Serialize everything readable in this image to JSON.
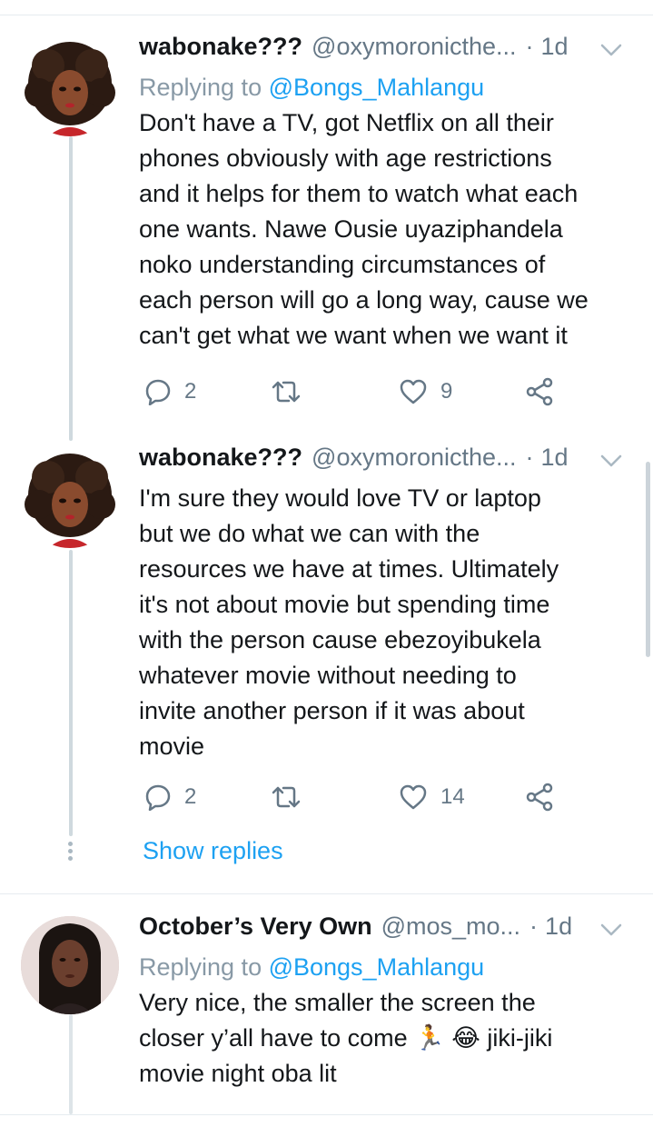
{
  "tweets": [
    {
      "name": "wabonake???",
      "handle": "@oxymoronicthe...",
      "dot": "·",
      "time": "1d",
      "replying_prefix": "Replying to ",
      "replying_to": "@Bongs_Mahlangu",
      "text": "Don't have a TV, got Netflix on all their\nphones obviously with age restrictions\nand it helps for them to watch what each\none wants. Nawe Ousie uyaziphandela\nnoko understanding circumstances of\neach person will go a long way, cause we\ncan't get what we want when we want it",
      "replies": "2",
      "retweets": "",
      "likes": "9"
    },
    {
      "name": "wabonake???",
      "handle": "@oxymoronicthe...",
      "dot": "·",
      "time": "1d",
      "text": "I'm sure they would love TV or laptop\nbut we do what we can with the\nresources we have at times. Ultimately\nit's not about movie but spending time\nwith the person cause  ebezoyibukela\nwhatever movie without needing to\ninvite another person if it was about\nmovie",
      "replies": "2",
      "retweets": "",
      "likes": "14"
    },
    {
      "name": "October’s Very Own",
      "handle": "@mos_mo...",
      "dot": "·",
      "time": "1d",
      "replying_prefix": "Replying to ",
      "replying_to": "@Bongs_Mahlangu",
      "text_before": "Very nice, the smaller the screen the\ncloser y’all have to come ",
      "emoji_1": "🏃",
      "emoji_2": "😂",
      "text_after": " jiki-jiki\nmovie night oba lit"
    }
  ],
  "show_replies": "Show replies",
  "colors": {
    "accent": "#1da1f2",
    "secondary_text": "#657786",
    "thread_line": "#cfd9de"
  },
  "icons": [
    "reply-icon",
    "retweet-icon",
    "like-icon",
    "share-icon",
    "chevron-down-icon"
  ]
}
